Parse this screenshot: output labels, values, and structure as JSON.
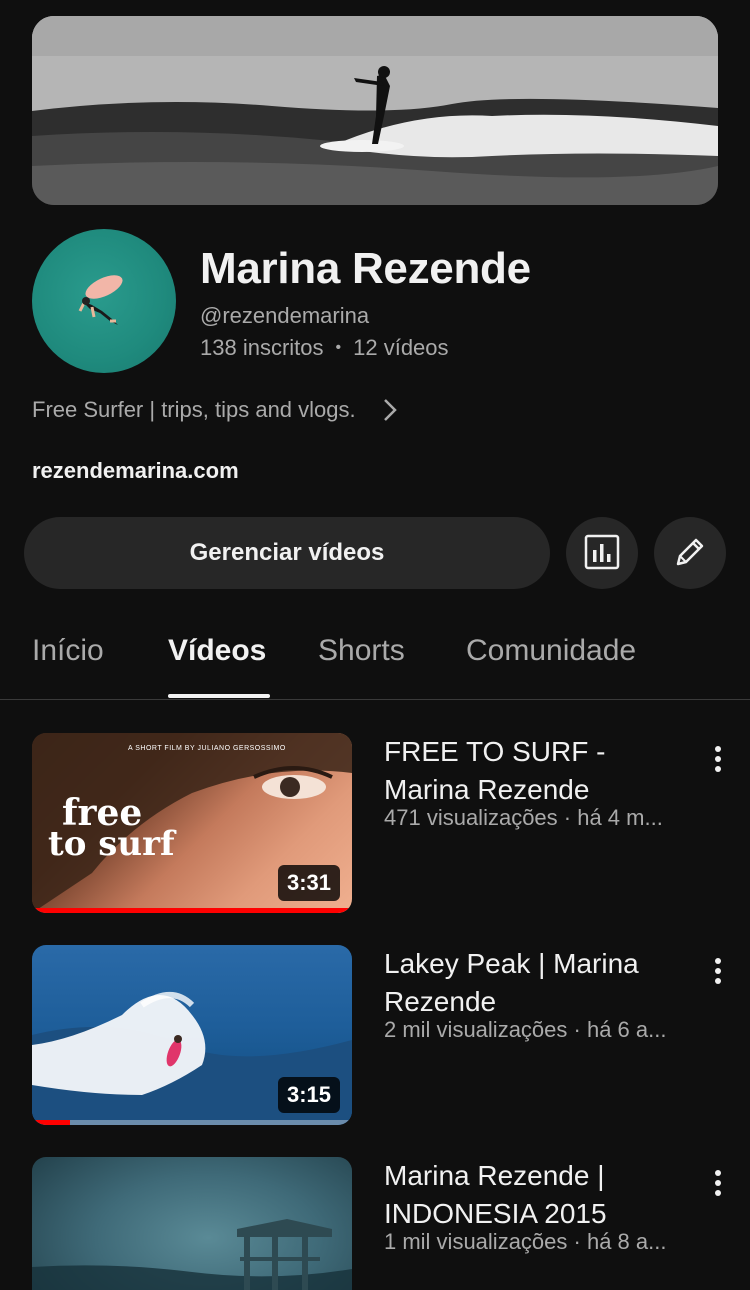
{
  "channel": {
    "name": "Marina Rezende",
    "handle": "@rezendemarina",
    "subscribers": "138 inscritos",
    "separator": "•",
    "video_count": "12 vídeos",
    "description": "Free Surfer | trips, tips and vlogs.",
    "link": "rezendemarina.com"
  },
  "actions": {
    "manage_label": "Gerenciar vídeos",
    "analytics_icon": "analytics-icon",
    "edit_icon": "pencil-icon"
  },
  "tabs": [
    {
      "label": "Início",
      "active": false
    },
    {
      "label": "Vídeos",
      "active": true
    },
    {
      "label": "Shorts",
      "active": false
    },
    {
      "label": "Comunidade",
      "active": false
    }
  ],
  "videos": [
    {
      "title": "FREE TO SURF - Marina Rezende",
      "meta": "471 visualizações · há 4 m...",
      "duration": "3:31",
      "thumb_text_line1": "free",
      "thumb_text_line2": "to surf",
      "thumb_credit": "A SHORT FILM BY JULIANO GERSOSSIMO",
      "watched_fraction": 1.0
    },
    {
      "title": "Lakey Peak | Marina Rezende",
      "meta": "2 mil visualizações · há 6 a...",
      "duration": "3:15",
      "watched_fraction": 0.12
    },
    {
      "title": "Marina Rezende | INDONESIA 2015",
      "meta": "1 mil visualizações · há 8 a...",
      "duration": "",
      "watched_fraction": 0
    }
  ],
  "colors": {
    "background": "#0f0f0f",
    "surface": "#272727",
    "text_primary": "#f1f1f1",
    "text_secondary": "#aaaaaa",
    "progress": "#ff0000",
    "avatar_teal": "#1f8a7d"
  }
}
